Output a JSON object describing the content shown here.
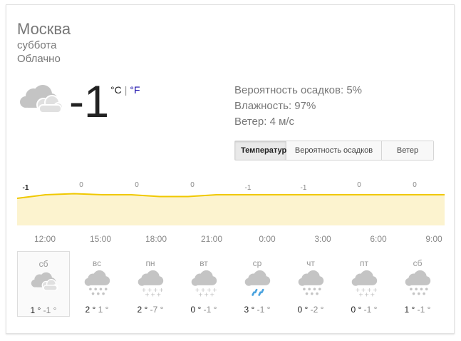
{
  "location": "Москва",
  "day": "суббота",
  "condition": "Облачно",
  "current": {
    "temp": "-1",
    "unit_c": "°C",
    "unit_sep": "|",
    "unit_f": "°F",
    "icon": "cloudy-icon"
  },
  "details": {
    "precip": "Вероятность осадков: 5%",
    "humidity": "Влажность: 97%",
    "wind": "Ветер: 4 м/с"
  },
  "tabs": {
    "temperature": "Температура",
    "precipitation": "Вероятность осадков",
    "wind": "Ветер"
  },
  "chart_data": {
    "type": "area",
    "categories": [
      "12:00",
      "15:00",
      "18:00",
      "21:00",
      "0:00",
      "3:00",
      "6:00",
      "9:00"
    ],
    "x_labels": [
      "12:00",
      "15:00",
      "18:00",
      "21:00",
      "0:00",
      "3:00",
      "6:00",
      "9:00"
    ],
    "labels": [
      "-1",
      "0",
      "0",
      "0",
      "-1",
      "-1",
      "0",
      "0"
    ],
    "values": [
      -1,
      0,
      0.3,
      0,
      0,
      -0.5,
      -0.5,
      0,
      0,
      0,
      0,
      0,
      0,
      0,
      0,
      0
    ],
    "line_color": "#f0c800",
    "fill_color": "#fcf3cf"
  },
  "forecast": [
    {
      "day": "сб",
      "hi": "1 °",
      "lo": "-1 °",
      "icon": "cloudy-icon",
      "selected": true
    },
    {
      "day": "вс",
      "hi": "2 °",
      "lo": "1 °",
      "icon": "snow-icon"
    },
    {
      "day": "пн",
      "hi": "2 °",
      "lo": "-7 °",
      "icon": "light-snow-icon"
    },
    {
      "day": "вт",
      "hi": "0 °",
      "lo": "-1 °",
      "icon": "light-snow-icon"
    },
    {
      "day": "ср",
      "hi": "3 °",
      "lo": "-1 °",
      "icon": "rain-icon"
    },
    {
      "day": "чт",
      "hi": "0 °",
      "lo": "-2 °",
      "icon": "snow-icon"
    },
    {
      "day": "пт",
      "hi": "0 °",
      "lo": "-1 °",
      "icon": "light-snow-icon"
    },
    {
      "day": "сб",
      "hi": "1 °",
      "lo": "-1 °",
      "icon": "snow-icon"
    }
  ]
}
